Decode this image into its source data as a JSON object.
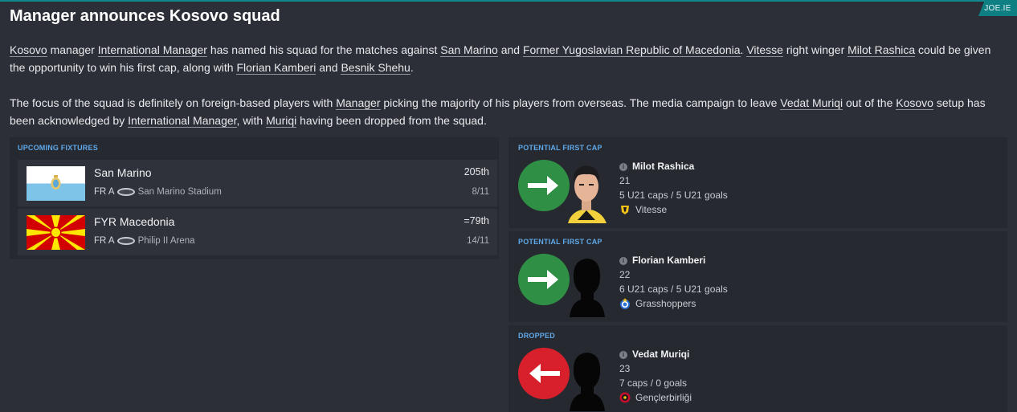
{
  "brand": "JOE.IE",
  "title": "Manager announces Kosovo squad",
  "story": {
    "p1": {
      "country": "Kosovo",
      "t1": " manager ",
      "manager": "International Manager",
      "t2": " has named his squad for the matches against ",
      "opp1": "San Marino",
      "t3": " and ",
      "opp2": "Former Yugoslavian Republic of Macedonia",
      "t4": ". ",
      "club": "Vitesse",
      "t5": " right winger ",
      "player1": "Milot Rashica",
      "t6": " could be given the opportunity to win his first cap, along with ",
      "player2": "Florian Kamberi",
      "t7": " and ",
      "player3": "Besnik Shehu",
      "t8": "."
    },
    "p2": {
      "t1": "The focus of the squad is definitely on foreign-based players with ",
      "mgr_short": "Manager",
      "t2": " picking the majority of his players from overseas. The media campaign to leave ",
      "player": "Vedat Muriqi",
      "t3": " out of the ",
      "country": "Kosovo",
      "t4": " setup has been acknowledged by ",
      "manager": "International Manager",
      "t5": ", with ",
      "surname": "Muriqi",
      "t6": " having been dropped from the squad."
    }
  },
  "fixtures": {
    "label": "UPCOMING FIXTURES",
    "items": [
      {
        "opponent": "San Marino",
        "comp": "FR",
        "venue_flag": "A",
        "stadium": "San Marino Stadium",
        "rank": "205th",
        "date": "8/11"
      },
      {
        "opponent": "FYR Macedonia",
        "comp": "FR",
        "venue_flag": "A",
        "stadium": "Philip II Arena",
        "rank": "=79th",
        "date": "14/11"
      }
    ]
  },
  "players": [
    {
      "section": "POTENTIAL FIRST CAP",
      "name": "Milot Rashica",
      "age": "21",
      "caps": "5 U21 caps / 5 U21 goals",
      "club": "Vitesse",
      "status_icon": "arrow-right-icon",
      "color": "#2f8f45"
    },
    {
      "section": "POTENTIAL FIRST CAP",
      "name": "Florian Kamberi",
      "age": "22",
      "caps": "6 U21 caps / 5 U21 goals",
      "club": "Grasshoppers",
      "status_icon": "arrow-right-icon",
      "color": "#2f8f45"
    },
    {
      "section": "DROPPED",
      "name": "Vedat Muriqi",
      "age": "23",
      "caps": "7 caps / 0 goals",
      "club": "Gençlerbirliği",
      "status_icon": "arrow-left-icon",
      "color": "#d7202b"
    }
  ]
}
